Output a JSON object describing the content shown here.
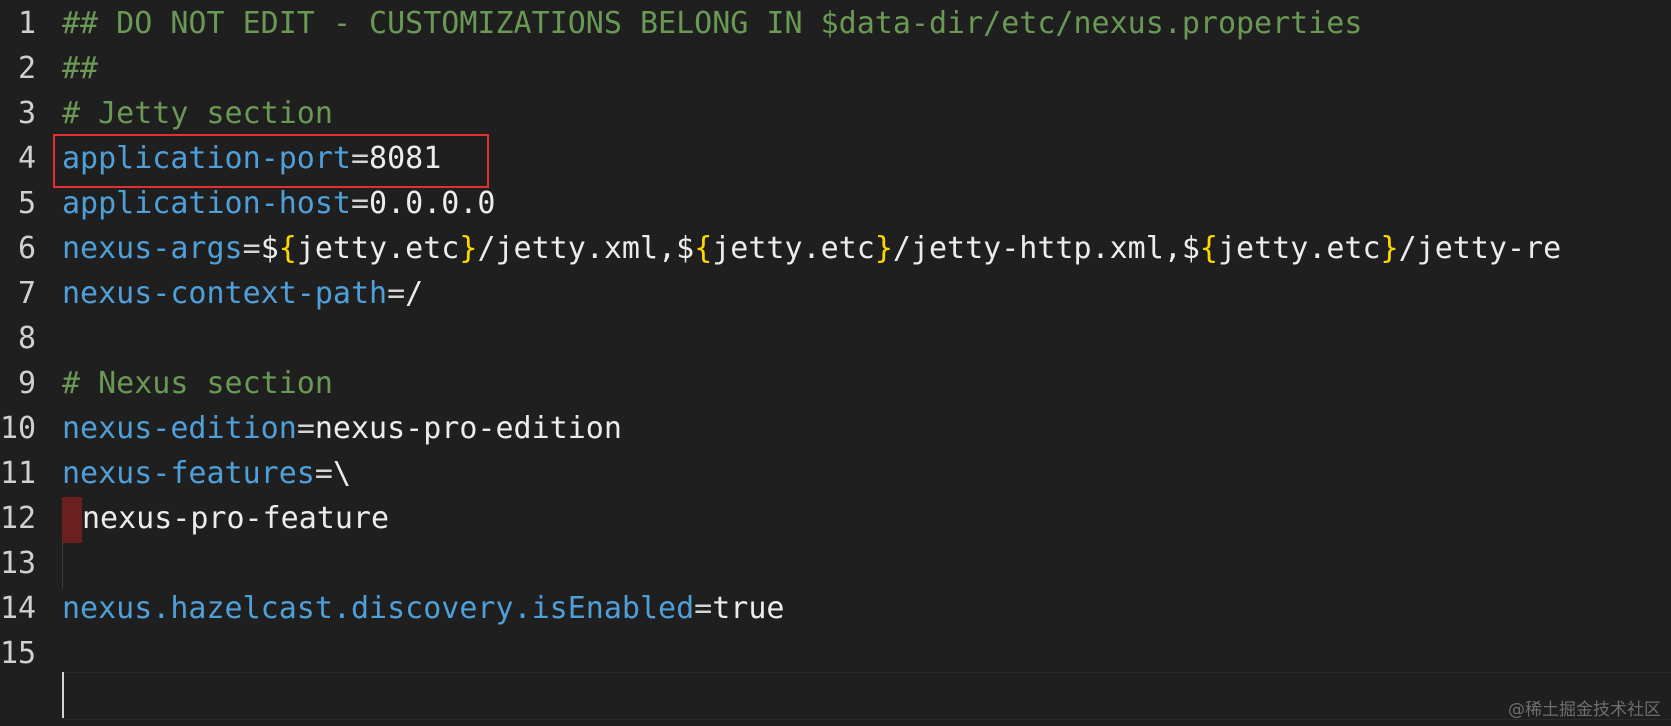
{
  "editor": {
    "lines": [
      {
        "num": "1",
        "comment": "## DO NOT EDIT - CUSTOMIZATIONS BELONG IN $data-dir/etc/nexus.properties"
      },
      {
        "num": "2",
        "comment": "##"
      },
      {
        "num": "3",
        "comment": "# Jetty section"
      },
      {
        "num": "4",
        "key": "application-port",
        "eq": "=",
        "value": "8081"
      },
      {
        "num": "5",
        "key": "application-host",
        "eq": "=",
        "value": "0.0.0.0"
      },
      {
        "num": "6",
        "key": "nexus-args",
        "eq": "=",
        "parts": [
          "$",
          "{",
          "jetty.etc",
          "}",
          "/jetty.xml,$",
          "{",
          "jetty.etc",
          "}",
          "/jetty-http.xml,$",
          "{",
          "jetty.etc",
          "}",
          "/jetty-re"
        ]
      },
      {
        "num": "7",
        "key": "nexus-context-path",
        "eq": "=",
        "value": "/"
      },
      {
        "num": "8"
      },
      {
        "num": "9",
        "comment": "# Nexus section"
      },
      {
        "num": "10",
        "key": "nexus-edition",
        "eq": "=",
        "value": "nexus-pro-edition"
      },
      {
        "num": "11",
        "key": "nexus-features",
        "eq": "=",
        "value": "\\"
      },
      {
        "num": "12",
        "value": "nexus-pro-feature"
      },
      {
        "num": "13"
      },
      {
        "num": "14",
        "key": "nexus.hazelcast.discovery.isEnabled",
        "eq": "=",
        "value": "true"
      },
      {
        "num": "15"
      }
    ]
  },
  "watermark": "@稀土掘金技术社区",
  "colors": {
    "background": "#1f1f1f",
    "comment": "#6a9955",
    "key": "#4f9fd9",
    "value": "#ececec",
    "brace": "#ffd700",
    "highlight_box": "#e0302f"
  }
}
